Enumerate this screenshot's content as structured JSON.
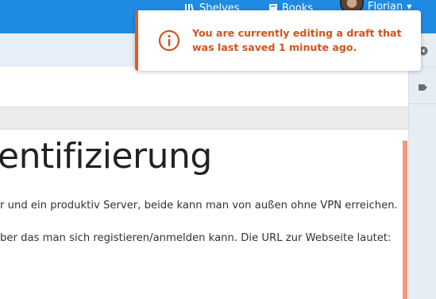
{
  "header": {
    "nav": {
      "shelves_label": "Shelves",
      "books_label": "Books",
      "user_name": "Florian"
    },
    "colors": {
      "header_bg": "#1f8be3",
      "toast_accent": "#e15c1a"
    }
  },
  "notification": {
    "message": "You are currently editing a draft that was last saved 1 minute ago.",
    "icon": "info-circle-icon"
  },
  "sidebar": {
    "buttons": [
      "collapse-left-icon",
      "tag-icon"
    ]
  },
  "editor": {
    "heading": "entifizierung",
    "paragraphs": [
      "r und ein produktiv Server, beide kann man von außen ohne VPN erreichen.",
      "ber das man sich registieren/anmelden kann. Die URL zur Webseite lautet:"
    ]
  }
}
